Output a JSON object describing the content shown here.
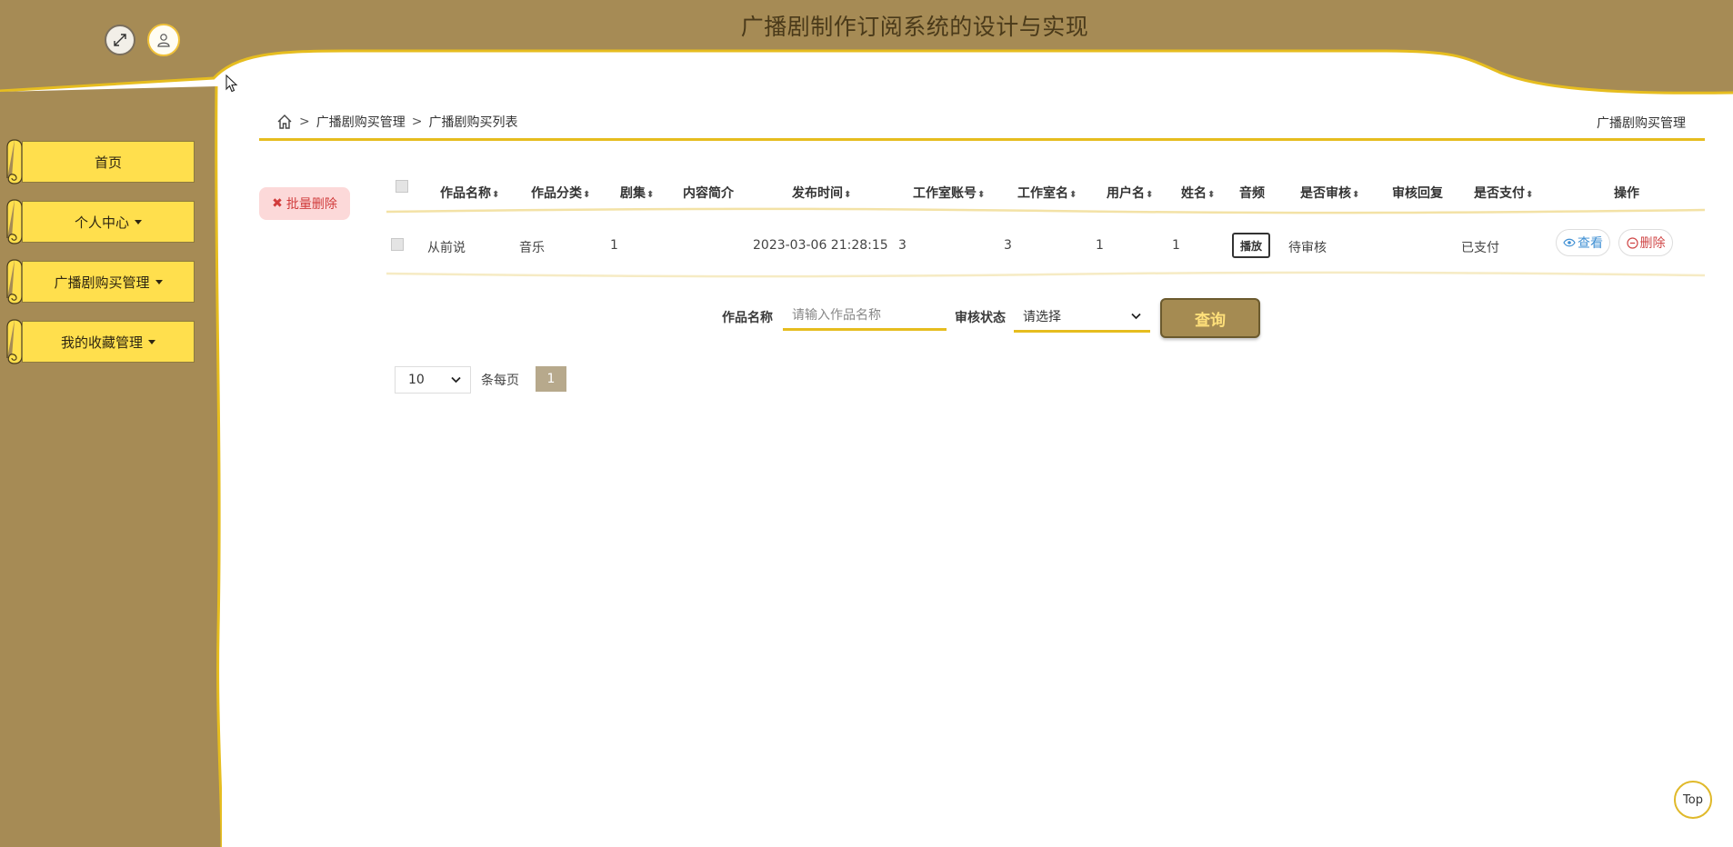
{
  "header": {
    "title": "广播剧制作订阅系统的设计与实现",
    "expand_icon": "expand-arrows-icon",
    "user_icon": "user-icon"
  },
  "colors": {
    "header_bg": "#a68b55",
    "sidebar_bg": "#a68b55",
    "accent_gold": "#e6bd1f",
    "menu_yellow": "#ffdf4d",
    "batch_delete_bg": "#fcd9d9",
    "query_button_bg": "#a58b52"
  },
  "sidebar": {
    "items": [
      {
        "label": "首页",
        "has_caret": false
      },
      {
        "label": "个人中心",
        "has_caret": true
      },
      {
        "label": "广播剧购买管理",
        "has_caret": true
      },
      {
        "label": "我的收藏管理",
        "has_caret": true
      }
    ]
  },
  "breadcrumb": {
    "home_icon": "home-icon",
    "separator": ">",
    "level1": "广播剧购买管理",
    "level2": "广播剧购买列表"
  },
  "page_label": "广播剧购买管理",
  "toolbar": {
    "batch_delete_icon": "x-icon",
    "batch_delete_label": "批量删除"
  },
  "table": {
    "columns": [
      {
        "label": "作品名称",
        "sortable": true
      },
      {
        "label": "作品分类",
        "sortable": true
      },
      {
        "label": "剧集",
        "sortable": true
      },
      {
        "label": "内容简介",
        "sortable": false
      },
      {
        "label": "发布时间",
        "sortable": true
      },
      {
        "label": "工作室账号",
        "sortable": true
      },
      {
        "label": "工作室名",
        "sortable": true
      },
      {
        "label": "用户名",
        "sortable": true
      },
      {
        "label": "姓名",
        "sortable": true
      },
      {
        "label": "音频",
        "sortable": false
      },
      {
        "label": "是否审核",
        "sortable": true
      },
      {
        "label": "审核回复",
        "sortable": false
      },
      {
        "label": "是否支付",
        "sortable": true
      },
      {
        "label": "操作",
        "sortable": false
      }
    ],
    "sort_icon": "sort-arrows-icon",
    "rows": [
      {
        "work_name": "从前说",
        "category": "音乐",
        "episodes": "1",
        "summary": "",
        "publish_time": "2023-03-06 21:28:15",
        "studio_account": "3",
        "studio_name": "3",
        "username": "1",
        "name": "1",
        "audio_button": "播放",
        "review_status": "待审核",
        "review_reply": "",
        "payment_status": "已支付",
        "view_label": "查看",
        "view_icon": "eye-icon",
        "delete_label": "删除",
        "delete_icon": "minus-circle-icon"
      }
    ]
  },
  "search": {
    "name_label": "作品名称",
    "name_placeholder": "请输入作品名称",
    "status_label": "审核状态",
    "status_selected": "请选择",
    "query_button": "查询"
  },
  "pagination": {
    "page_size": "10",
    "per_page_label": "条每页",
    "current_page": "1"
  },
  "back_to_top": "Top"
}
